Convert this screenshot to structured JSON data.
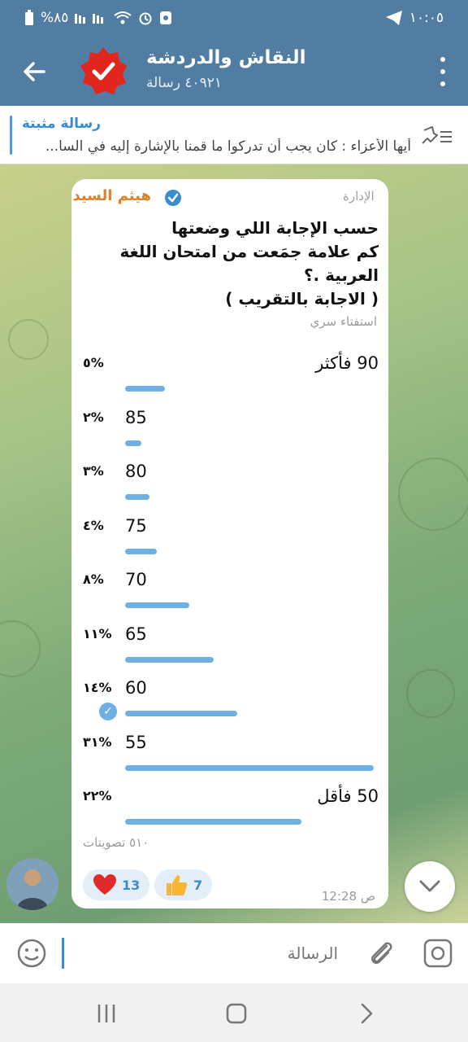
{
  "status_bar": {
    "time": "١٠:٠٥",
    "battery": "%٨٥"
  },
  "header": {
    "title": "النقاش والدردشة",
    "subtitle": "٤٠٩٢١ رسالة"
  },
  "pinned": {
    "title": "رسالة مثبتة",
    "text": "أيها الأعزاء : كان يجب أن تدركوا ما قمنا بالإشارة إليه في السا..."
  },
  "message": {
    "admin_tag": "الإدارة",
    "author": "هيثم السيد",
    "question": "حسب الإجابة اللي وضعتها\nكم علامة جمَعت من امتحان اللغة العربية .؟\n( الاجابة بالتقريب )",
    "poll_type": "استفتاء سري",
    "options": [
      {
        "label": "90 فأكثر",
        "percent": "٥%",
        "fill": 0.05,
        "rtl": true,
        "selected": false
      },
      {
        "label": "85",
        "percent": "٢%",
        "fill": 0.02,
        "rtl": false,
        "selected": false
      },
      {
        "label": "80",
        "percent": "٣%",
        "fill": 0.03,
        "rtl": false,
        "selected": false
      },
      {
        "label": "75",
        "percent": "٤%",
        "fill": 0.04,
        "rtl": false,
        "selected": false
      },
      {
        "label": "70",
        "percent": "٨%",
        "fill": 0.08,
        "rtl": false,
        "selected": false
      },
      {
        "label": "65",
        "percent": "١١%",
        "fill": 0.11,
        "rtl": false,
        "selected": false
      },
      {
        "label": "60",
        "percent": "١٤%",
        "fill": 0.14,
        "rtl": false,
        "selected": true
      },
      {
        "label": "55",
        "percent": "٣١%",
        "fill": 0.31,
        "rtl": false,
        "selected": false
      },
      {
        "label": "50 فأقل",
        "percent": "٢٢%",
        "fill": 0.22,
        "rtl": true,
        "selected": false
      }
    ],
    "votes": "٥١٠ تصويتات",
    "reactions": [
      {
        "emoji": "heart-icon",
        "count": "13"
      },
      {
        "emoji": "thumbs-up-icon",
        "count": "7"
      }
    ],
    "time": "12:28 ص"
  },
  "input": {
    "placeholder": "الرسالة"
  },
  "colors": {
    "header": "#517da2",
    "accent": "#3b8bcf",
    "poll_bar": "#6fb0e3",
    "author": "#d9822b"
  }
}
